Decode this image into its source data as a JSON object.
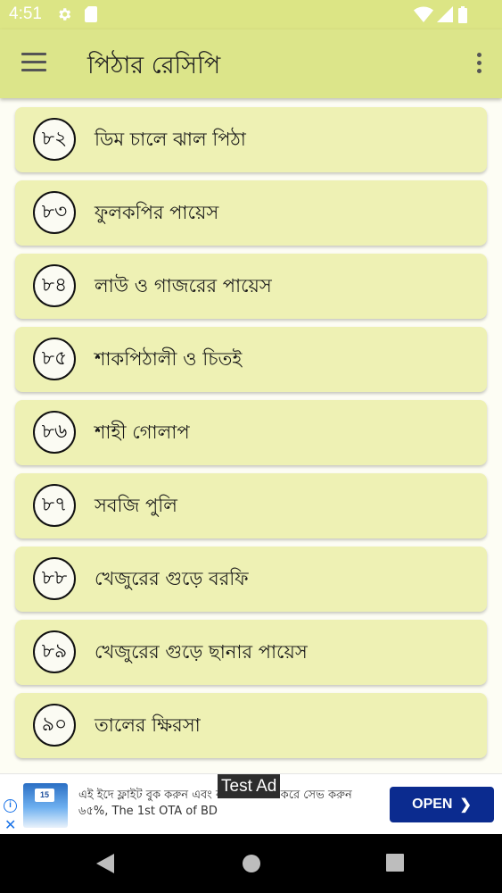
{
  "status_bar": {
    "time": "4:51",
    "icons": [
      "gear-icon",
      "sd-card-icon",
      "wifi-icon",
      "signal-icon",
      "battery-icon"
    ]
  },
  "app_bar": {
    "title": "পিঠার রেসিপি",
    "menu_icon": "hamburger-menu-icon",
    "overflow_icon": "more-vert-icon",
    "color": "#dce58a"
  },
  "recipes": [
    {
      "number": "৮২",
      "title": "ডিম চালে ঝাল পিঠা"
    },
    {
      "number": "৮৩",
      "title": "ফুলকপির পায়েস"
    },
    {
      "number": "৮৪",
      "title": "লাউ ও গাজরের পায়েস"
    },
    {
      "number": "৮৫",
      "title": "শাকপিঠালী ও চিতই"
    },
    {
      "number": "৮৬",
      "title": "শাহী গোলাপ"
    },
    {
      "number": "৮৭",
      "title": "সবজি পুলি"
    },
    {
      "number": "৮৮",
      "title": "খেজুরের গুড়ে বরফি"
    },
    {
      "number": "৮৯",
      "title": "খেজুরের গুড়ে ছানার পায়েস"
    },
    {
      "number": "৯০",
      "title": "তালের ক্ষিরসা"
    }
  ],
  "ad": {
    "tag": "Test Ad",
    "text": "এই ইদে ফ্লাইট বুক করুন এবং কার্ডে পেমেন্ট করে সেভ করুন ৬৫%, The 1st OTA of BD",
    "thumb_badge": "15",
    "button_label": "OPEN",
    "button_color": "#0b2b8f"
  },
  "nav_bar": {
    "buttons": [
      "back-icon",
      "home-icon",
      "recents-icon"
    ]
  }
}
